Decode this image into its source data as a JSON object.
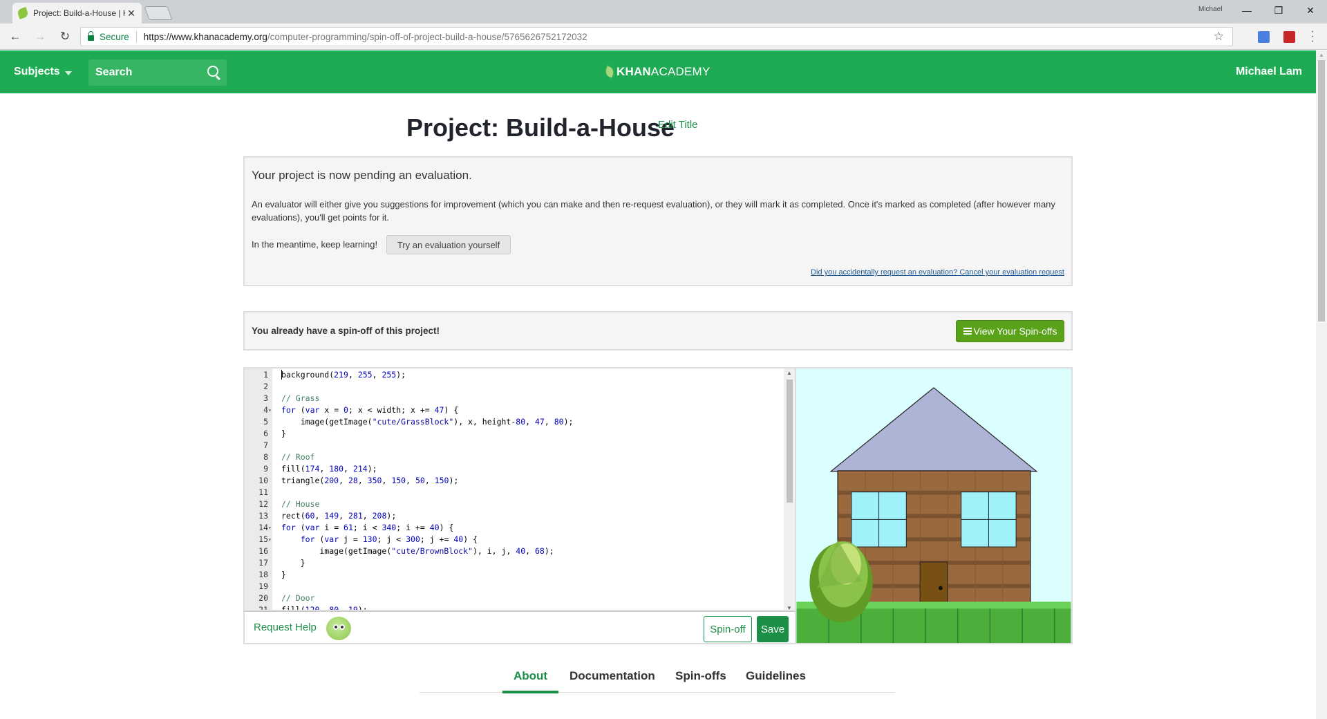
{
  "browser": {
    "tab_title": "Project: Build-a-House | K",
    "profile_name": "Michael",
    "secure_label": "Secure",
    "url_host": "https://www.khanacademy.org",
    "url_path": "/computer-programming/spin-off-of-project-build-a-house/5765626752172032"
  },
  "header": {
    "subjects_label": "Subjects",
    "search_label": "Search",
    "logo_bold": "KHAN",
    "logo_light": "ACADEMY",
    "user_name": "Michael Lam"
  },
  "page": {
    "title": "Project: Build-a-House",
    "edit_title": "Edit Title"
  },
  "evaluation": {
    "heading": "Your project is now pending an evaluation.",
    "body": "An evaluator will either give you suggestions for improvement (which you can make and then re-request evaluation), or they will mark it as completed. Once it's marked as completed (after however many evaluations), you'll get points for it.",
    "meantime": "In the meantime, keep learning!",
    "try_button": "Try an evaluation yourself",
    "cancel_link": "Did you accidentally request an evaluation? Cancel your evaluation request"
  },
  "spinoff_notice": {
    "text": "You already have a spin-off of this project!",
    "button": "View Your Spin-offs"
  },
  "editor": {
    "lines": [
      {
        "n": "1",
        "fold": "",
        "code": "background(219, 255, 255);"
      },
      {
        "n": "2",
        "fold": "",
        "code": ""
      },
      {
        "n": "3",
        "fold": "",
        "code": "// Grass"
      },
      {
        "n": "4",
        "fold": "▾",
        "code": "for (var x = 0; x < width; x += 47) {"
      },
      {
        "n": "5",
        "fold": "",
        "code": "    image(getImage(\"cute/GrassBlock\"), x, height-80, 47, 80);"
      },
      {
        "n": "6",
        "fold": "",
        "code": "}"
      },
      {
        "n": "7",
        "fold": "",
        "code": ""
      },
      {
        "n": "8",
        "fold": "",
        "code": "// Roof"
      },
      {
        "n": "9",
        "fold": "",
        "code": "fill(174, 180, 214);"
      },
      {
        "n": "10",
        "fold": "",
        "code": "triangle(200, 28, 350, 150, 50, 150);"
      },
      {
        "n": "11",
        "fold": "",
        "code": ""
      },
      {
        "n": "12",
        "fold": "",
        "code": "// House"
      },
      {
        "n": "13",
        "fold": "",
        "code": "rect(60, 149, 281, 208);"
      },
      {
        "n": "14",
        "fold": "▾",
        "code": "for (var i = 61; i < 340; i += 40) {"
      },
      {
        "n": "15",
        "fold": "▾",
        "code": "    for (var j = 130; j < 300; j += 40) {"
      },
      {
        "n": "16",
        "fold": "",
        "code": "        image(getImage(\"cute/BrownBlock\"), i, j, 40, 68);"
      },
      {
        "n": "17",
        "fold": "",
        "code": "    }"
      },
      {
        "n": "18",
        "fold": "",
        "code": "}"
      },
      {
        "n": "19",
        "fold": "",
        "code": ""
      },
      {
        "n": "20",
        "fold": "",
        "code": "// Door"
      },
      {
        "n": "21",
        "fold": "",
        "code": "fill(120, 80, 19);"
      }
    ],
    "request_help": "Request Help",
    "spinoff_button": "Spin-off",
    "save_button": "Save"
  },
  "canvas": {
    "colors": {
      "sky": "#dbffff",
      "roof": "#aeb4d6",
      "brick": "#9a6a3e",
      "window": "#9ff2fa",
      "door": "#785013",
      "grass": "#4caf3c"
    }
  },
  "tabs": [
    "About",
    "Documentation",
    "Spin-offs",
    "Guidelines"
  ]
}
